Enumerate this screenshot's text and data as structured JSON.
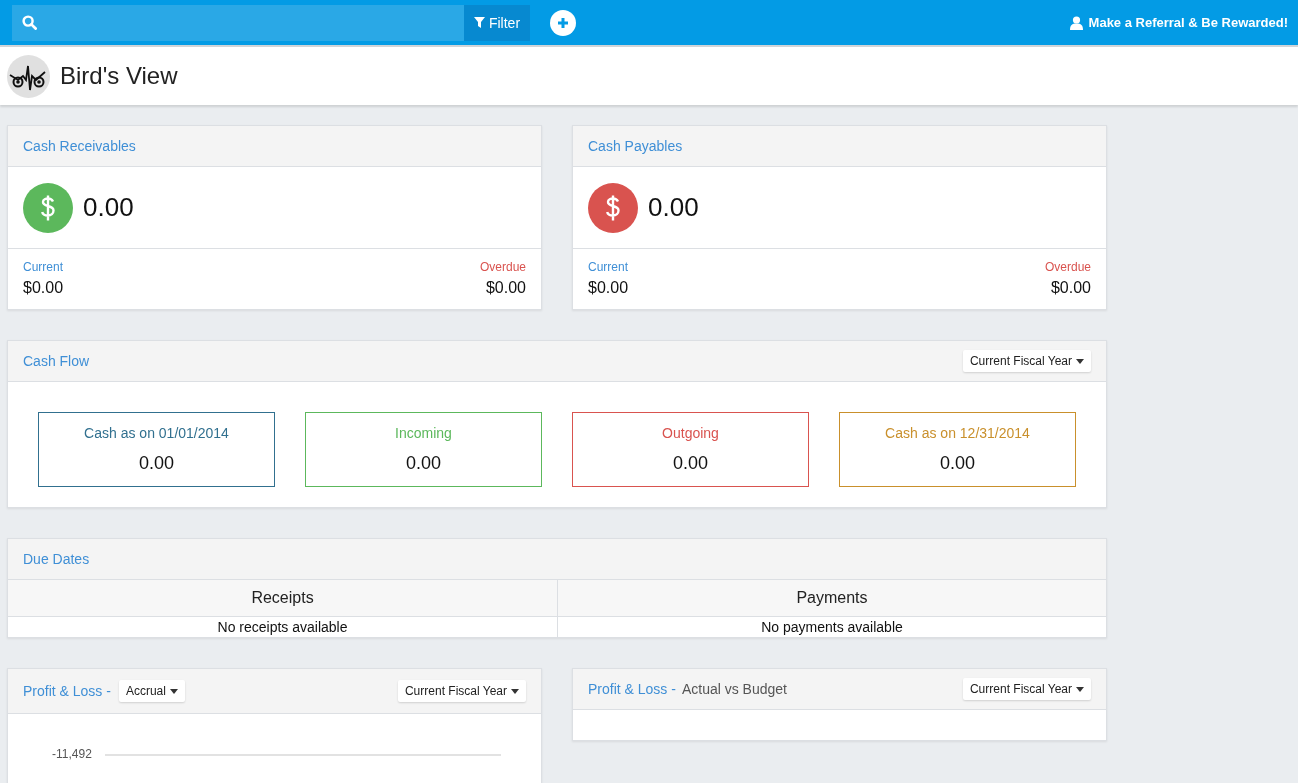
{
  "top_bar": {
    "filter_button": "Filter",
    "referral_link": "Make a Referral & Be Rewarded!"
  },
  "page_header": {
    "title": "Bird's View"
  },
  "summary_cards": [
    {
      "title": "Cash Receivables",
      "color": "#5cb85c",
      "amount": "0.00",
      "current_label": "Current",
      "current_value": "$0.00",
      "overdue_label": "Overdue",
      "overdue_value": "$0.00"
    },
    {
      "title": "Cash Payables",
      "color": "#d9534f",
      "amount": "0.00",
      "current_label": "Current",
      "current_value": "$0.00",
      "overdue_label": "Overdue",
      "overdue_value": "$0.00"
    }
  ],
  "cash_flow": {
    "title": "Cash Flow",
    "period": "Current Fiscal Year",
    "boxes": [
      {
        "label": "Cash as on 01/01/2014",
        "value": "0.00",
        "color": "#31708f"
      },
      {
        "label": "Incoming",
        "value": "0.00",
        "color": "#5cb85c"
      },
      {
        "label": "Outgoing",
        "value": "0.00",
        "color": "#d9534f"
      },
      {
        "label": "Cash as on 12/31/2014",
        "value": "0.00",
        "color": "#c9902c"
      }
    ]
  },
  "due_dates": {
    "title": "Due Dates",
    "columns": [
      {
        "heading": "Receipts",
        "empty": "No receipts available"
      },
      {
        "heading": "Payments",
        "empty": "No payments available"
      }
    ]
  },
  "profit_loss": {
    "title": "Profit & Loss -",
    "basis": "Accrual",
    "period": "Current Fiscal Year",
    "axis_label": "-11,492"
  },
  "profit_loss_budget": {
    "title": "Profit & Loss -",
    "subtitle": "Actual vs Budget",
    "period": "Current Fiscal Year"
  }
}
